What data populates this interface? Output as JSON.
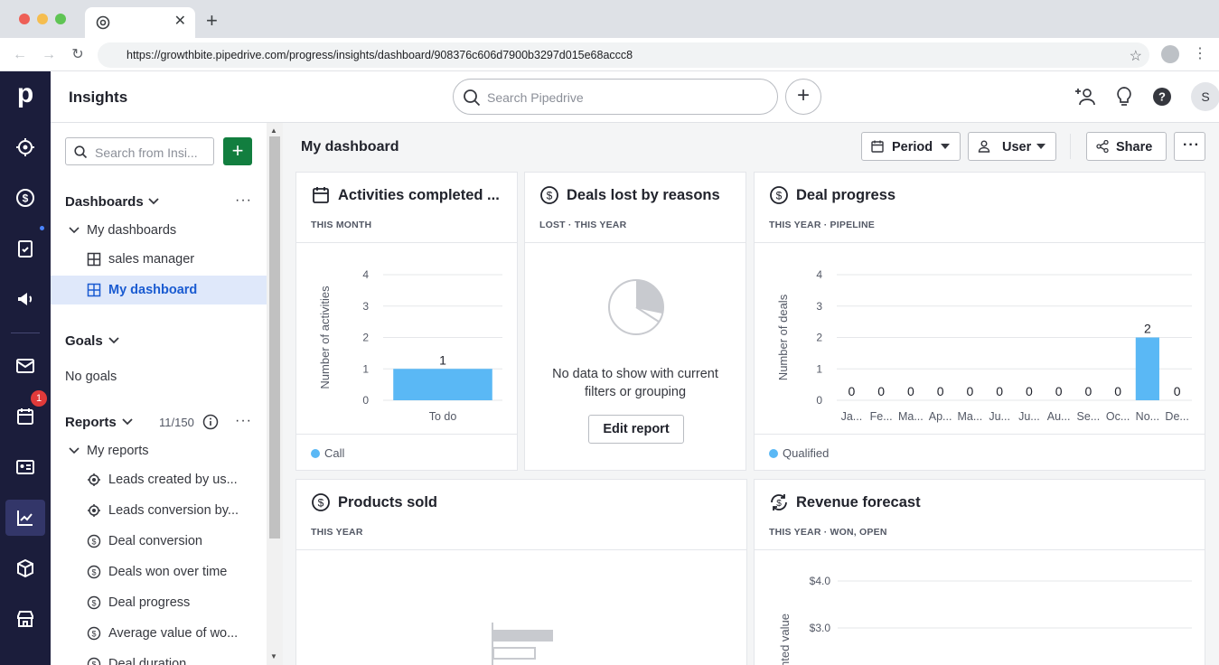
{
  "browser": {
    "url": "https://growthbite.pipedrive.com/progress/insights/dashboard/908376c606d7900b3297d015e68accc8"
  },
  "header": {
    "title": "Insights",
    "search_placeholder": "Search Pipedrive",
    "avatar_initial": "S"
  },
  "nav": {
    "badge_count": "1"
  },
  "sidebar": {
    "search_placeholder": "Search from Insi...",
    "add_label": "+",
    "dashboards_title": "Dashboards",
    "my_dashboards": "My dashboards",
    "dashboard_items": [
      "sales manager",
      "My dashboard"
    ],
    "goals_title": "Goals",
    "no_goals": "No goals",
    "reports_title": "Reports",
    "reports_count": "11/150",
    "my_reports": "My reports",
    "report_items": [
      {
        "label": "Leads created by us...",
        "icon": "target-icon"
      },
      {
        "label": "Leads conversion by...",
        "icon": "target-icon"
      },
      {
        "label": "Deal conversion",
        "icon": "dollar-icon"
      },
      {
        "label": "Deals won over time",
        "icon": "dollar-icon"
      },
      {
        "label": "Deal progress",
        "icon": "dollar-icon"
      },
      {
        "label": "Average value of wo...",
        "icon": "dollar-icon"
      },
      {
        "label": "Deal duration",
        "icon": "dollar-icon"
      }
    ]
  },
  "main": {
    "title": "My dashboard",
    "period_label": "Period",
    "user_label": "User",
    "share_label": "Share"
  },
  "cards": {
    "activities": {
      "title": "Activities completed ...",
      "subtitle": "THIS MONTH",
      "legend": "Call"
    },
    "deals_lost": {
      "title": "Deals lost by reasons",
      "subtitle": "LOST  ·  THIS YEAR",
      "no_data": "No data to show with current",
      "no_data_2": "filters or grouping",
      "edit_label": "Edit report"
    },
    "deal_progress": {
      "title": "Deal progress",
      "subtitle": "THIS YEAR  ·  PIPELINE",
      "legend": "Qualified"
    },
    "products_sold": {
      "title": "Products sold",
      "subtitle": "THIS YEAR"
    },
    "revenue_forecast": {
      "title": "Revenue forecast",
      "subtitle": "THIS YEAR  ·  WON, OPEN"
    }
  },
  "colors": {
    "nav_bg": "#1b1d3b",
    "bar": "#5ab8f5",
    "accent_green": "#127e3f",
    "active_blue": "#1a5bd1"
  },
  "chart_data": [
    {
      "type": "bar",
      "categories": [
        "To do"
      ],
      "series": [
        {
          "name": "Call",
          "values": [
            1
          ]
        }
      ],
      "ylabel": "Number of activities",
      "ylim": [
        0,
        4
      ],
      "yticks": [
        "0",
        "1",
        "2",
        "3",
        "4"
      ],
      "data_labels": [
        "1"
      ]
    },
    {
      "type": "bar",
      "categories": [
        "Ja...",
        "Fe...",
        "Ma...",
        "Ap...",
        "Ma...",
        "Ju...",
        "Ju...",
        "Au...",
        "Se...",
        "Oc...",
        "No...",
        "De..."
      ],
      "series": [
        {
          "name": "Qualified",
          "values": [
            0,
            0,
            0,
            0,
            0,
            0,
            0,
            0,
            0,
            0,
            2,
            0
          ]
        }
      ],
      "ylabel": "Number of deals",
      "ylim": [
        0,
        4
      ],
      "yticks": [
        "0",
        "1",
        "2",
        "3",
        "4"
      ]
    },
    {
      "type": "line",
      "ylabel": "...nted value",
      "yticks": [
        "$4.0",
        "$3.0"
      ]
    }
  ]
}
